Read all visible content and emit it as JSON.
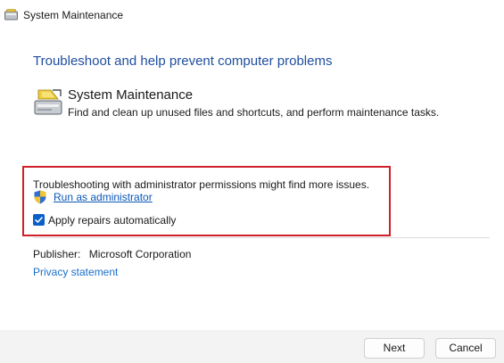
{
  "window": {
    "title": "System Maintenance",
    "icon": "system-maintenance-icon"
  },
  "main": {
    "headline": "Troubleshoot and help prevent computer problems",
    "tool": {
      "name": "System Maintenance",
      "description": "Find and clean up unused files and shortcuts, and perform maintenance tasks.",
      "icon": "system-maintenance-icon"
    },
    "admin_section": {
      "info_text": "Troubleshooting with administrator permissions might find more issues.",
      "run_as_admin_link": "Run as administrator",
      "shield_icon": "uac-shield-icon",
      "highlight_color": "#d0202a"
    },
    "apply_repairs": {
      "label": "Apply repairs automatically",
      "checked": true
    },
    "publisher": {
      "label": "Publisher:",
      "value": "Microsoft Corporation"
    },
    "privacy_link": "Privacy statement"
  },
  "footer": {
    "next_label": "Next",
    "cancel_label": "Cancel"
  },
  "colors": {
    "accent": "#0a5fc8",
    "headline": "#1f4e9e",
    "link": "#0b57b8"
  }
}
